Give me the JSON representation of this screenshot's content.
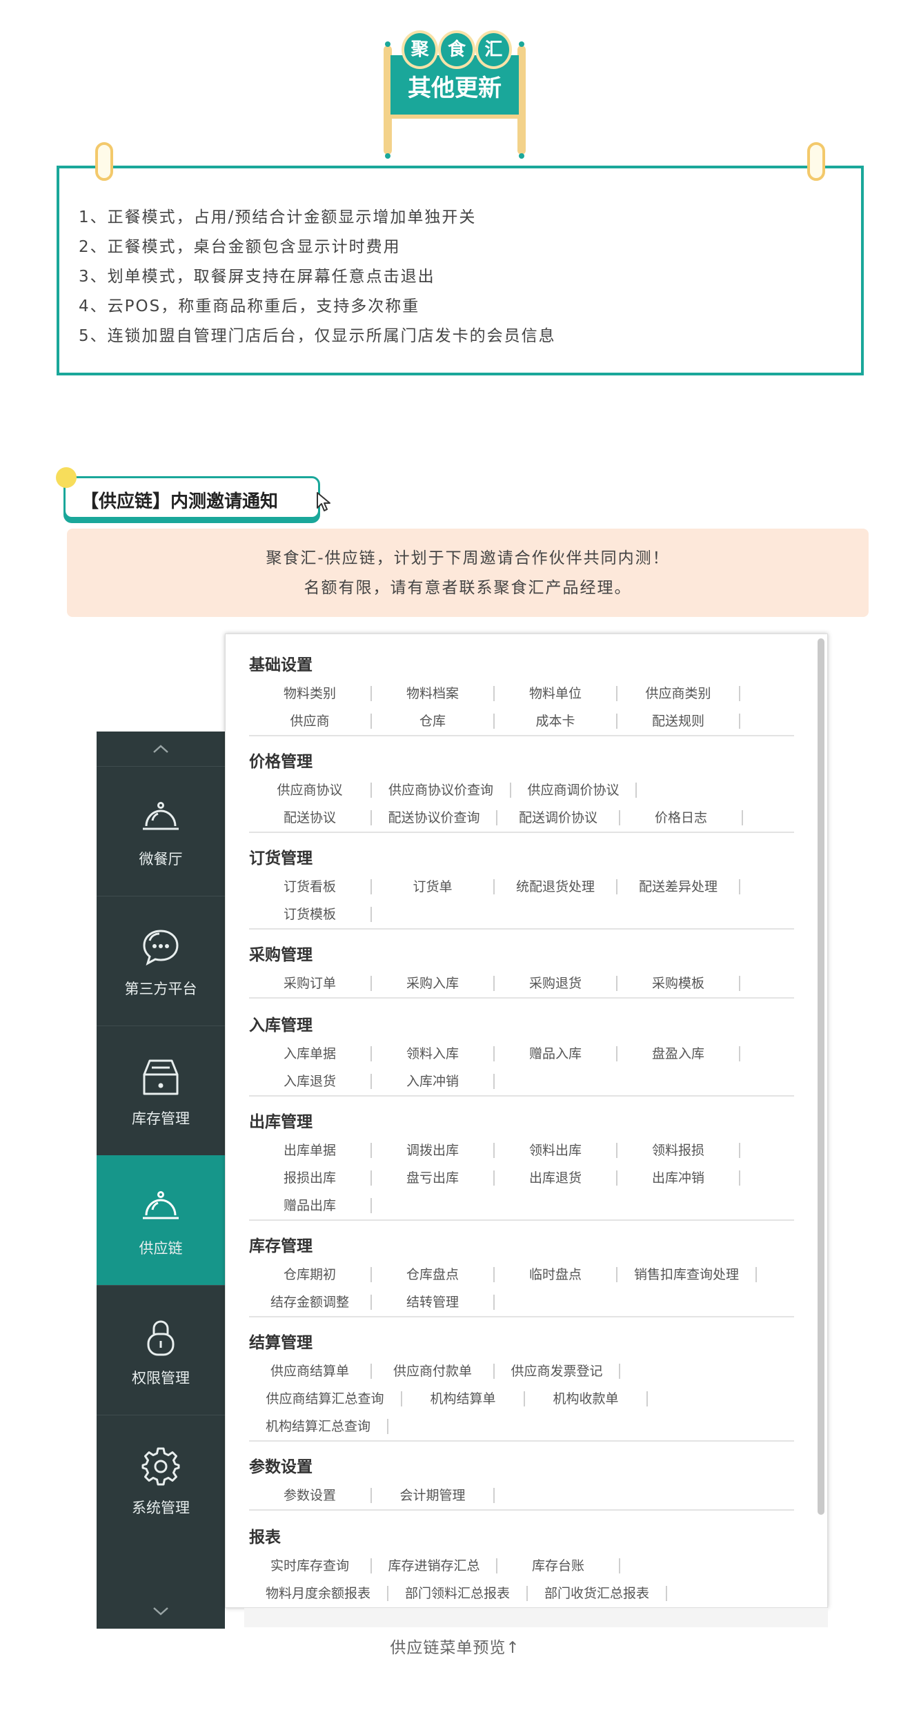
{
  "badge": {
    "circles": [
      "聚",
      "食",
      "汇"
    ],
    "title": "其他更新"
  },
  "updates": [
    "1、正餐模式，占用/预结合计金额显示增加单独开关",
    "2、正餐模式，桌台金额包含显示计时费用",
    "3、划单模式，取餐屏支持在屏幕任意点击退出",
    "4、云POS，称重商品称重后，支持多次称重",
    "5、连锁加盟自管理门店后台，仅显示所属门店发卡的会员信息"
  ],
  "invite": {
    "tab_title": "【供应链】内测邀请通知",
    "line1": "聚食汇-供应链，计划于下周邀请合作伙伴共同内测！",
    "line2": "名额有限，请有意者联系聚食汇产品经理。"
  },
  "sidebar": {
    "items": [
      {
        "label": "微餐厅",
        "icon": "cloche-icon"
      },
      {
        "label": "第三方平台",
        "icon": "chat-bubble-icon"
      },
      {
        "label": "库存管理",
        "icon": "inventory-box-icon"
      },
      {
        "label": "供应链",
        "icon": "cloche-icon",
        "active": true
      },
      {
        "label": "权限管理",
        "icon": "lock-icon"
      },
      {
        "label": "系统管理",
        "icon": "gear-icon"
      }
    ]
  },
  "menu": {
    "sections": [
      {
        "title": "基础设置",
        "rows": [
          [
            "物料类别",
            "物料档案",
            "物料单位",
            "供应商类别"
          ],
          [
            "供应商",
            "仓库",
            "成本卡",
            "配送规则"
          ]
        ]
      },
      {
        "title": "价格管理",
        "rows": [
          [
            "供应商协议",
            "供应商协议价查询",
            "供应商调价协议"
          ],
          [
            "配送协议",
            "配送协议价查询",
            "配送调价协议",
            "价格日志"
          ]
        ]
      },
      {
        "title": "订货管理",
        "rows": [
          [
            "订货看板",
            "订货单",
            "统配退货处理",
            "配送差异处理"
          ],
          [
            "订货模板"
          ]
        ]
      },
      {
        "title": "采购管理",
        "rows": [
          [
            "采购订单",
            "采购入库",
            "采购退货",
            "采购模板"
          ]
        ]
      },
      {
        "title": "入库管理",
        "rows": [
          [
            "入库单据",
            "领料入库",
            "赠品入库",
            "盘盈入库"
          ],
          [
            "入库退货",
            "入库冲销"
          ]
        ]
      },
      {
        "title": "出库管理",
        "rows": [
          [
            "出库单据",
            "调拨出库",
            "领料出库",
            "领料报损"
          ],
          [
            "报损出库",
            "盘亏出库",
            "出库退货",
            "出库冲销"
          ],
          [
            "赠品出库"
          ]
        ]
      },
      {
        "title": "库存管理",
        "rows": [
          [
            "仓库期初",
            "仓库盘点",
            "临时盘点",
            "销售扣库查询处理"
          ],
          [
            "结存金额调整",
            "结转管理"
          ]
        ]
      },
      {
        "title": "结算管理",
        "rows": [
          [
            "供应商结算单",
            "供应商付款单",
            "供应商发票登记"
          ],
          [
            "供应商结算汇总查询",
            "机构结算单",
            "机构收款单"
          ],
          [
            "机构结算汇总查询"
          ]
        ]
      },
      {
        "title": "参数设置",
        "rows": [
          [
            "参数设置",
            "会计期管理"
          ]
        ]
      },
      {
        "title": "报表",
        "rows": [
          [
            "实时库存查询",
            "库存进销存汇总",
            "库存台账"
          ],
          [
            "物料月度余额报表",
            "部门领料汇总报表",
            "部门收货汇总报表"
          ]
        ]
      }
    ]
  },
  "caption": "供应链菜单预览↑"
}
